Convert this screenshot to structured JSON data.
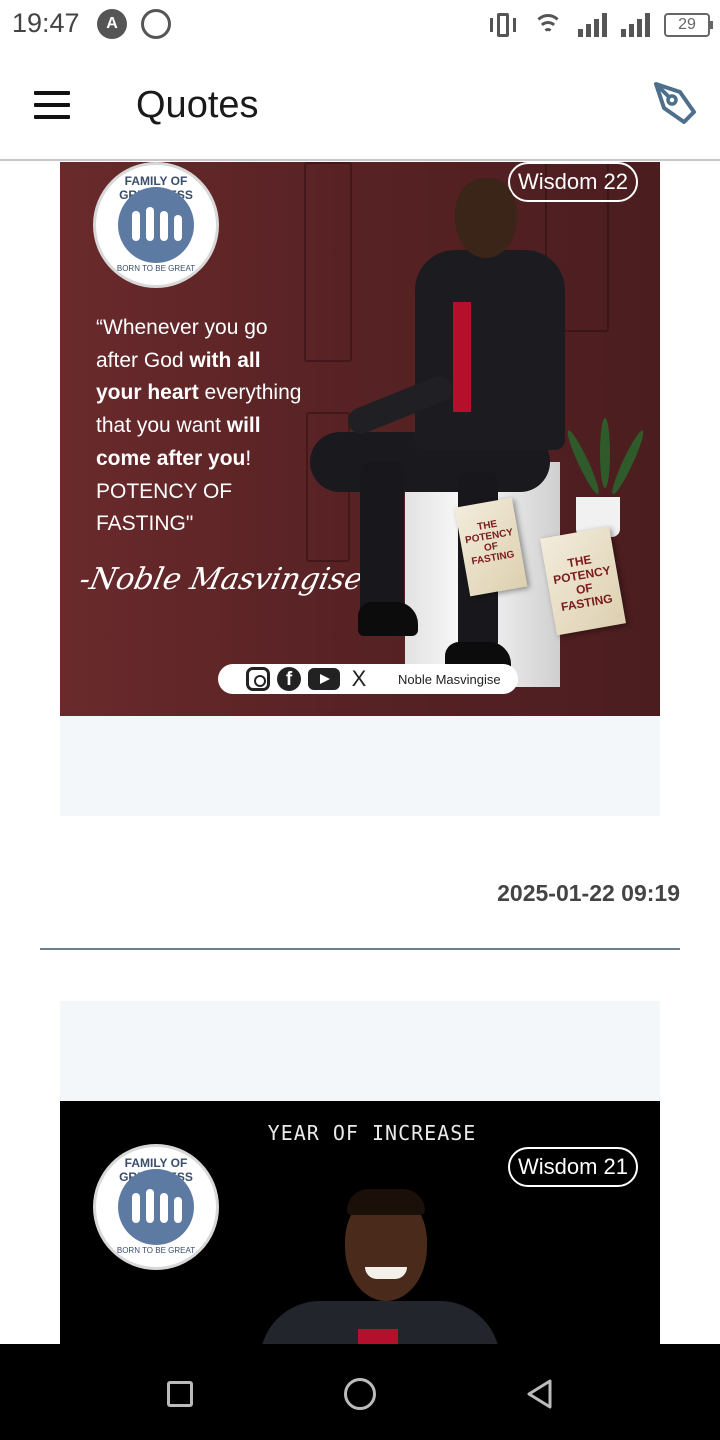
{
  "status_bar": {
    "time": "19:47",
    "app_icon_1": "A",
    "app_icon_2_name": "whatsapp-icon",
    "battery": "29"
  },
  "app_bar": {
    "title": "Quotes",
    "menu_icon": "hamburger-menu-icon",
    "action_icon": "pen-nib-icon"
  },
  "posts": [
    {
      "tag": "Wisdom 22",
      "logo": {
        "top_text": "FAMILY OF GREATNESS",
        "bottom_text": "BORN TO BE GREAT"
      },
      "quote": {
        "l1": "“Whenever you go",
        "l2a": "after God ",
        "l2b": "with all",
        "l3a": "your heart",
        "l3b": " everything",
        "l4a": "that you want ",
        "l4b": "will",
        "l5a": "come after you",
        "l5b": "!",
        "l6": "POTENCY OF",
        "l7": "FASTING\""
      },
      "signature": "-Noble Masvingise",
      "book": {
        "w1": "THE",
        "w2": "POTENCY",
        "w3": "OF FASTING"
      },
      "social": {
        "fb": "f",
        "x": "X",
        "name": "Noble Masvingise"
      },
      "timestamp": "2025-01-22 09:19"
    },
    {
      "header": "YEAR OF INCREASE",
      "tag": "Wisdom 21",
      "logo": {
        "top_text": "FAMILY OF GREATNESS",
        "bottom_text": "BORN TO BE GREAT"
      }
    }
  ],
  "colors": {
    "maroon_bg": "#5a2325",
    "caption_bg": "#f3f7fa",
    "divider": "#6d7f8e",
    "accent_icon": "#4e6f8c"
  }
}
